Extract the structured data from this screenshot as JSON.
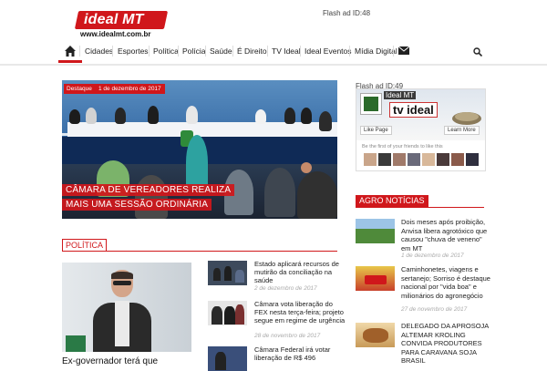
{
  "header": {
    "logo_text": "ideal MT",
    "logo_url": "www.idealmt.com.br",
    "flash_ad": "Flash ad ID:48"
  },
  "nav": {
    "items": [
      "Cidades",
      "Esportes",
      "Política",
      "Polícia",
      "Saúde",
      "É Direito",
      "TV Ideal",
      "Ideal Eventos",
      "Mídia Digital"
    ]
  },
  "hero": {
    "tag": "Destaque",
    "date": "1 de dezembro de 2017",
    "caption_line1": "CÂMARA DE VEREADORES REALIZA",
    "caption_line2": "MAIS UMA SESSÃO ORDINÁRIA"
  },
  "politica": {
    "heading": "POLÍTICA",
    "main_title": "Ex-governador terá que",
    "items": [
      {
        "title": "Estado aplicará recursos de mutirão da conciliação na saúde",
        "date": "2 de dezembro de 2017"
      },
      {
        "title": "Câmara vota liberação do FEX nesta terça-feira; projeto segue em regime de urgência",
        "date": "28 de novembro de 2017"
      },
      {
        "title": "Câmara Federal irá votar liberação de R$ 496",
        "date": ""
      }
    ]
  },
  "sidebar": {
    "flash_ad": "Flash ad ID:49",
    "facebook": {
      "page_name": "Ideal MT",
      "logo": "tv ideal",
      "like_label": "Like Page",
      "learn_label": "Learn More",
      "friends_text": "Be the first of your friends to like this"
    },
    "agro_heading": "AGRO NOTÍCIAS",
    "agro_items": [
      {
        "title": "Dois meses após proibição, Anvisa libera agrotóxico que causou \"chuva de veneno\" em MT",
        "date": "1 de dezembro de 2017"
      },
      {
        "title": "Caminhonetes, viagens e sertanejo; Sorriso é destaque nacional por \"vida boa\" e milionários do agronegócio",
        "date": "27 de novembro de 2017"
      },
      {
        "title": "DELEGADO DA APROSOJA ALTEMAR KROLING CONVIDA PRODUTORES PARA CARAVANA SOJA BRASIL",
        "date": ""
      }
    ]
  },
  "colors": {
    "brand": "#d0171b",
    "text": "#222222"
  }
}
